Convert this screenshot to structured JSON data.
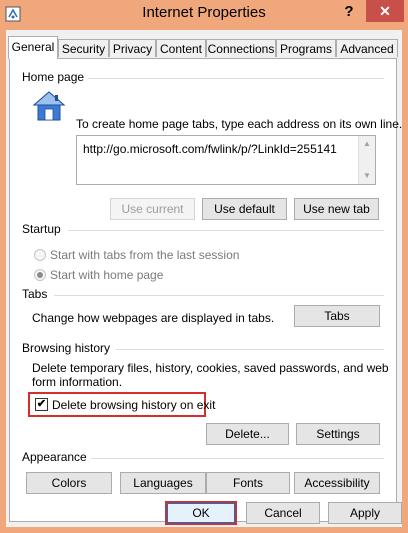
{
  "window": {
    "title": "Internet Properties",
    "help": "?",
    "close": "✕"
  },
  "tabs": [
    {
      "label": "General",
      "active": true
    },
    {
      "label": "Security"
    },
    {
      "label": "Privacy"
    },
    {
      "label": "Content"
    },
    {
      "label": "Connections"
    },
    {
      "label": "Programs"
    },
    {
      "label": "Advanced"
    }
  ],
  "home_page": {
    "section_label": "Home page",
    "instructions": "To create home page tabs, type each address on its own line.",
    "url": "http://go.microsoft.com/fwlink/p/?LinkId=255141",
    "use_current": "Use current",
    "use_default": "Use default",
    "use_new_tab": "Use new tab"
  },
  "startup": {
    "section_label": "Startup",
    "option_last_session": "Start with tabs from the last session",
    "option_home_page": "Start with home page",
    "selected": "home_page"
  },
  "tabs_section": {
    "section_label": "Tabs",
    "description": "Change how webpages are displayed in tabs.",
    "button": "Tabs"
  },
  "browsing_history": {
    "section_label": "Browsing history",
    "description_line1": "Delete temporary files, history, cookies, saved passwords, and web",
    "description_line2": "form information.",
    "delete_on_exit_label": "Delete browsing history on exit",
    "delete_on_exit_checked": true,
    "delete_button": "Delete...",
    "settings_button": "Settings"
  },
  "appearance": {
    "section_label": "Appearance",
    "colors": "Colors",
    "languages": "Languages",
    "fonts": "Fonts",
    "accessibility": "Accessibility"
  },
  "dialog_buttons": {
    "ok": "OK",
    "cancel": "Cancel",
    "apply": "Apply"
  },
  "colors": {
    "frame": "#efa77b",
    "close_button": "#c7504a",
    "highlight": "#d32f2f"
  }
}
